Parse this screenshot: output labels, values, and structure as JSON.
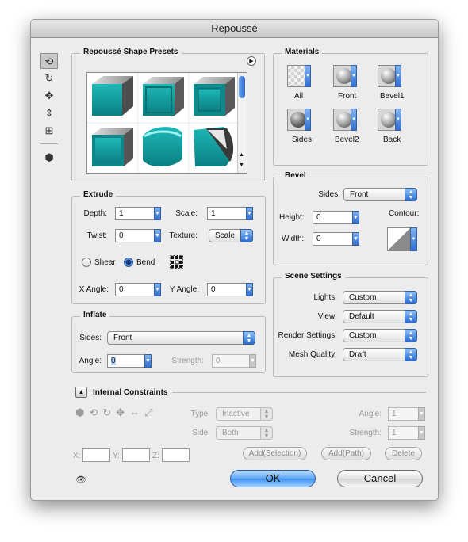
{
  "window": {
    "title": "Repoussé"
  },
  "presets": {
    "title": "Repoussé Shape Presets"
  },
  "extrude": {
    "title": "Extrude",
    "depth_label": "Depth:",
    "depth_value": "1",
    "scale_label": "Scale:",
    "scale_value": "1",
    "twist_label": "Twist:",
    "twist_value": "0",
    "texture_label": "Texture:",
    "texture_value": "Scale",
    "shear_label": "Shear",
    "bend_label": "Bend",
    "xangle_label": "X Angle:",
    "xangle_value": "0",
    "yangle_label": "Y Angle:",
    "yangle_value": "0"
  },
  "inflate": {
    "title": "Inflate",
    "sides_label": "Sides:",
    "sides_value": "Front",
    "angle_label": "Angle:",
    "angle_value": "0",
    "strength_label": "Strength:",
    "strength_value": "0"
  },
  "materials": {
    "title": "Materials",
    "items": [
      "All",
      "Front",
      "Bevel1",
      "Sides",
      "Bevel2",
      "Back"
    ]
  },
  "bevel": {
    "title": "Bevel",
    "sides_label": "Sides:",
    "sides_value": "Front",
    "height_label": "Height:",
    "height_value": "0",
    "width_label": "Width:",
    "width_value": "0",
    "contour_label": "Contour:"
  },
  "scene": {
    "title": "Scene Settings",
    "lights_label": "Lights:",
    "lights_value": "Custom",
    "view_label": "View:",
    "view_value": "Default",
    "render_label": "Render Settings:",
    "render_value": "Custom",
    "mesh_label": "Mesh Quality:",
    "mesh_value": "Draft"
  },
  "constraints": {
    "title": "Internal Constraints",
    "type_label": "Type:",
    "type_value": "Inactive",
    "side_label": "Side:",
    "side_value": "Both",
    "angle_label": "Angle:",
    "angle_value": "1",
    "strength_label": "Strength:",
    "strength_value": "1",
    "x_label": "X:",
    "y_label": "Y:",
    "z_label": "Z:",
    "add_selection_label": "Add(Selection)",
    "add_path_label": "Add(Path)",
    "delete_label": "Delete"
  },
  "buttons": {
    "ok_label": "OK",
    "cancel_label": "Cancel"
  },
  "colors": {
    "accent": "#3d8ff0",
    "teal_shape": "#16a8a8"
  }
}
